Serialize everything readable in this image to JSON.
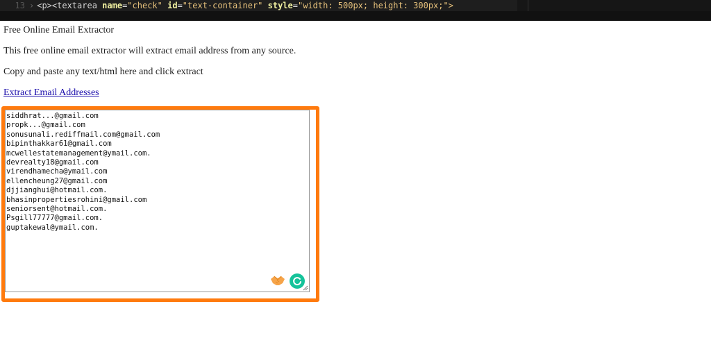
{
  "editor": {
    "line_number": "13",
    "code_open": "<p><textarea ",
    "attr1": "name",
    "eq1": "=",
    "val1": "\"check\"",
    "attr2": "id",
    "eq2": "=",
    "val2": "\"text-container\"",
    "attr3": "style",
    "eq3": "=",
    "val3": "\"width: 500px; height: 300px;\">"
  },
  "page": {
    "title": "Free Online Email Extractor",
    "description": "This free online email extractor will extract email address from any source.",
    "instruction": "Copy and paste any text/html here and click extract",
    "extract_link": "Extract Email Addresses"
  },
  "textarea": {
    "emails": [
      "siddhrat...@gmail.com",
      "propk...@gmail.com",
      "sonusunali.rediffmail.com@gmail.com",
      "bipinthakkar61@gmail.com",
      "mcwellestatemanagement@ymail.com.",
      "devrealty18@gmail.com",
      "virendhamecha@ymail.com",
      "ellencheung27@gmail.com",
      "djjianghui@hotmail.com.",
      "bhasinpropertiesrohini@gmail.com",
      "seniorsent@hotmail.com.",
      "Psgill77777@gmail.com.",
      "guptakewal@ymail.com."
    ]
  },
  "colors": {
    "highlight_border": "#ff7a0d",
    "link": "#1a0dab",
    "grammarly": "#15c39a"
  },
  "icons": {
    "extension_1": "handshake-icon",
    "extension_2": "grammarly-icon",
    "resize": "resize-grip-icon"
  }
}
